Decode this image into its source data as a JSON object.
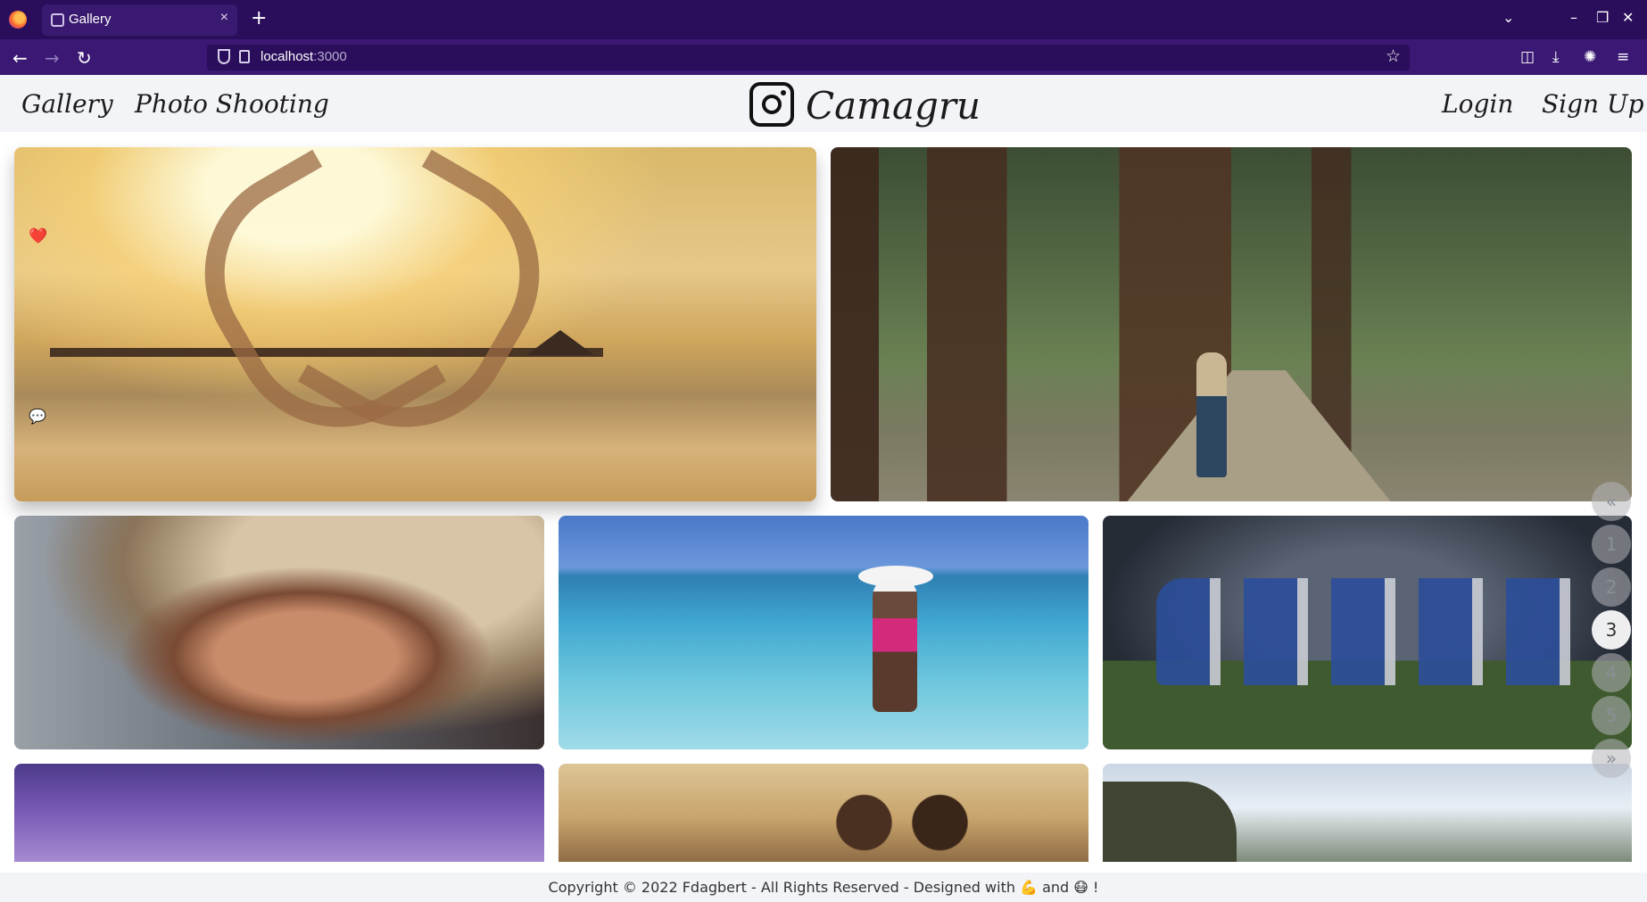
{
  "browser": {
    "tab_title": "Gallery",
    "tab_close": "×",
    "new_tab": "+",
    "url_host": "localhost",
    "url_port": ":3000",
    "icons": [
      "firefox-icon",
      "back-icon",
      "forward-icon",
      "reload-icon",
      "shield-icon",
      "page-icon",
      "star-icon",
      "pocket-icon",
      "download-icon",
      "extensions-icon",
      "menu-icon"
    ]
  },
  "header": {
    "nav_gallery": "Gallery",
    "nav_photo": "Photo Shooting",
    "brand": "Camagru",
    "login": "Login",
    "signup": "Sign Up"
  },
  "gallery": {
    "like_icon": "❤️",
    "comment_icon": "💬"
  },
  "pagination": {
    "prev": "«",
    "pages": [
      "1",
      "2",
      "3",
      "4",
      "5"
    ],
    "active": "3",
    "next": "»"
  },
  "footer": {
    "text": "Copyright © 2022 Fdagbert - All Rights Reserved - Designed with 💪 and 😷 !"
  }
}
